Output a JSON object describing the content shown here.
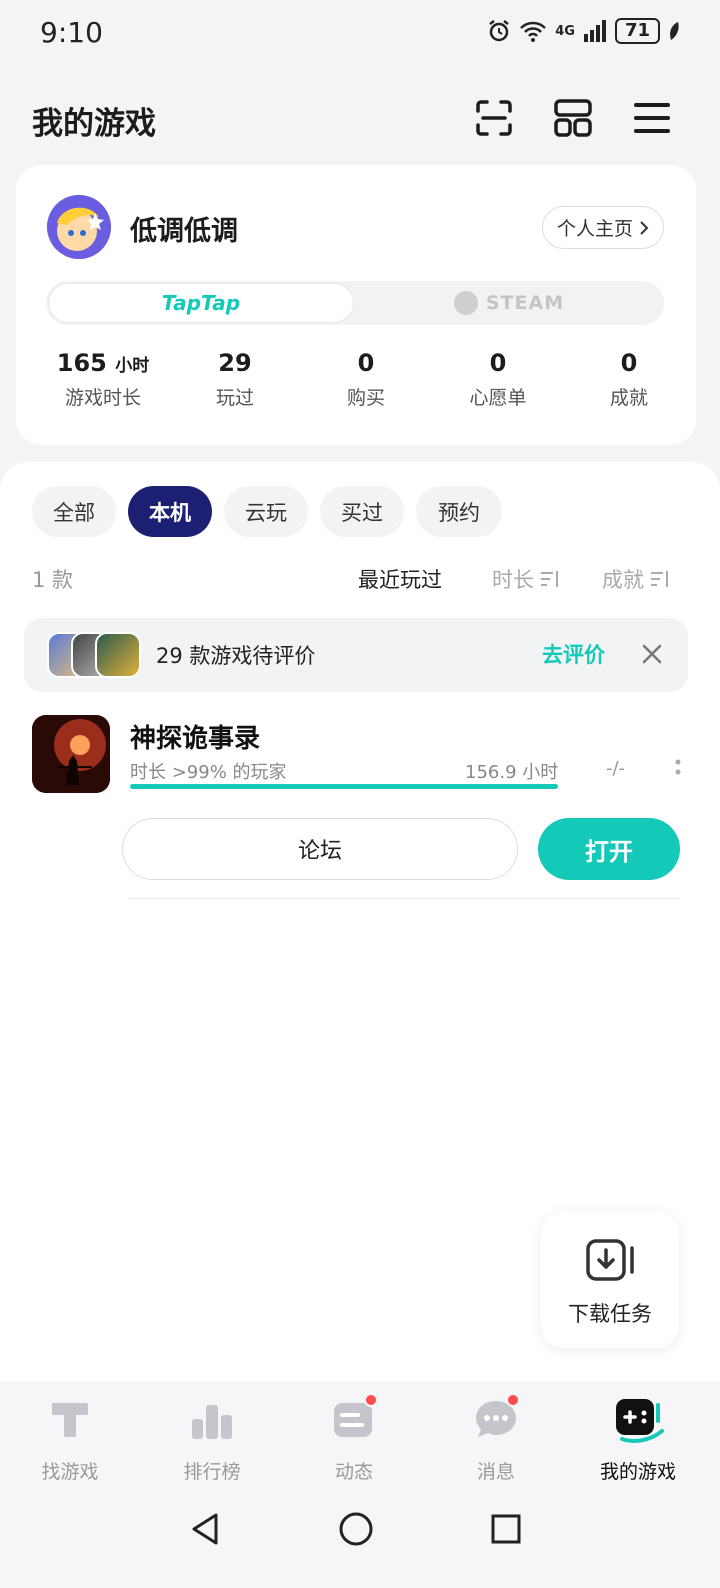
{
  "status_bar": {
    "time": "9:10",
    "signal_label": "4G",
    "battery": "71"
  },
  "header": {
    "title": "我的游戏"
  },
  "profile": {
    "username": "低调低调",
    "profile_button": "个人主页",
    "platforms": {
      "taptap": "TapTap",
      "steam": "STEAM"
    },
    "stats": [
      {
        "value": "165",
        "unit": "小时",
        "label": "游戏时长"
      },
      {
        "value": "29",
        "unit": "",
        "label": "玩过"
      },
      {
        "value": "0",
        "unit": "",
        "label": "购买"
      },
      {
        "value": "0",
        "unit": "",
        "label": "心愿单"
      },
      {
        "value": "0",
        "unit": "",
        "label": "成就"
      }
    ]
  },
  "filters": {
    "chips": [
      "全部",
      "本机",
      "云玩",
      "买过",
      "预约"
    ],
    "active": "本机"
  },
  "list_meta": {
    "count": "1 款",
    "sort_recent": "最近玩过",
    "sort_duration": "时长",
    "sort_achievement": "成就"
  },
  "review_banner": {
    "text": "29 款游戏待评价",
    "action": "去评价"
  },
  "game": {
    "name": "神探诡事录",
    "subtitle": "时长 >99% 的玩家",
    "hours": "156.9 小时",
    "score": "-/-",
    "progress": 1.0,
    "forum_button": "论坛",
    "open_button": "打开"
  },
  "download": {
    "label": "下载任务"
  },
  "bottom_nav": {
    "items": [
      "找游戏",
      "排行榜",
      "动态",
      "消息",
      "我的游戏"
    ],
    "active": "我的游戏"
  },
  "colors": {
    "accent": "#14c9b7",
    "chip_active": "#1d1f73",
    "badge": "#ff4d4f"
  }
}
